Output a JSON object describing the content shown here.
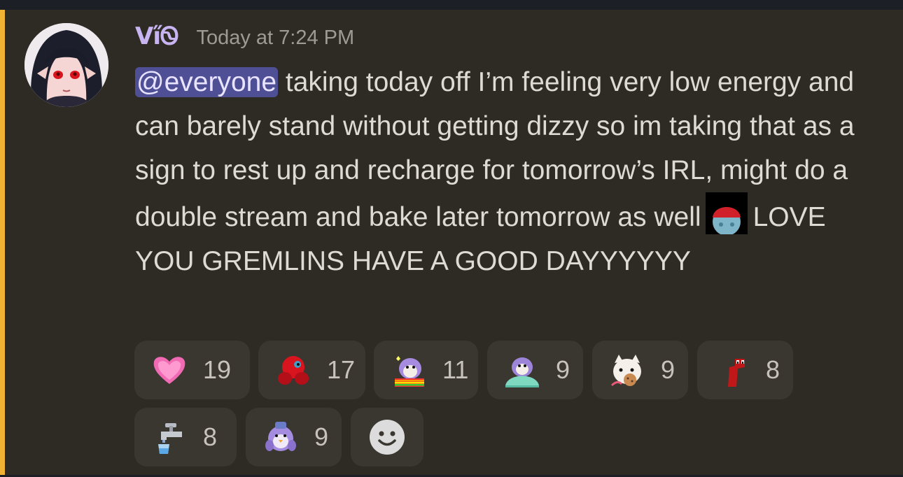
{
  "colors": {
    "background": "#2e2a24",
    "mention_bar": "#f0b232",
    "username": "#c9b4f2",
    "mention_bg": "#4f4f96",
    "reaction_bg": "#3a3630"
  },
  "message": {
    "author": "Vi̋Ꮻ",
    "timestamp": "Today at 7:24 PM",
    "mention": "@everyone",
    "text_part1": " taking today off I’m feeling very low energy and can barely stand without getting dizzy so im taking that as a sign to rest up and recharge for tomorrow’s IRL, might do a double stream and bake later tomorrow as well",
    "inline_emoji": "gremlin-emoji",
    "text_part2": "LOVE YOU GREMLINS HAVE A GOOD DAYYYYYY"
  },
  "reactions": [
    {
      "emoji": "pink-heart-icon",
      "count": "19"
    },
    {
      "emoji": "red-parrot-hug-icon",
      "count": "17"
    },
    {
      "emoji": "rainbow-penguin-icon",
      "count": "11"
    },
    {
      "emoji": "penguin-blanket-icon",
      "count": "9"
    },
    {
      "emoji": "cat-cookie-icon",
      "count": "9"
    },
    {
      "emoji": "red-worm-icon",
      "count": "8"
    },
    {
      "emoji": "faucet-icon",
      "count": "8"
    },
    {
      "emoji": "penguin-hug-icon",
      "count": "9"
    }
  ],
  "add_reaction": {
    "icon": "smiley-add-icon"
  }
}
